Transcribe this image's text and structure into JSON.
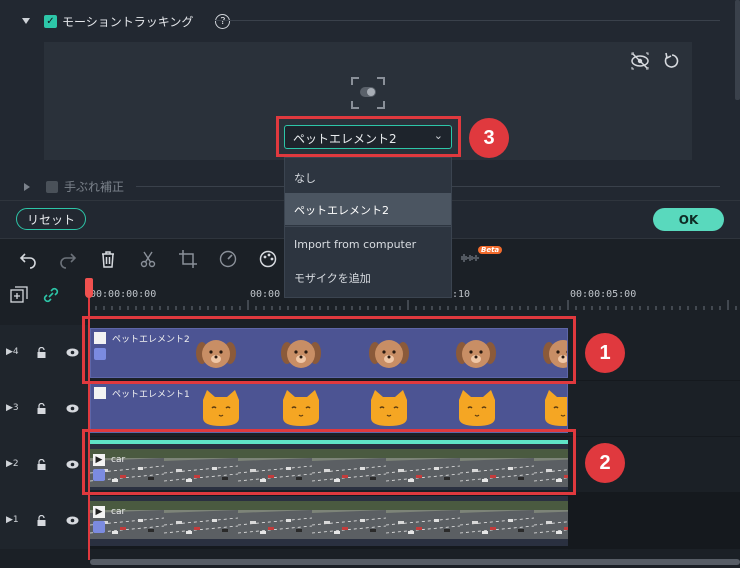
{
  "properties": {
    "motion_tracking_label": "モーショントラッキング",
    "help_symbol": "?",
    "selected_element": "ペットエレメント2",
    "stabilization_label": "手ぶれ補正",
    "reset_label": "リセット",
    "ok_label": "OK"
  },
  "dropdown": {
    "items": [
      "なし",
      "ペットエレメント2",
      "Import from computer",
      "モザイクを追加"
    ],
    "selected_index": 1
  },
  "toolbar": {
    "beta_label": "Beta",
    "icons": [
      "undo-icon",
      "redo-icon",
      "delete-icon",
      "cut-icon",
      "crop-icon",
      "speed-icon",
      "color-icon",
      "audio-icon"
    ]
  },
  "ruler": {
    "times": [
      "00:00:00:00",
      "00:00",
      ":10",
      "00:00:05:00"
    ]
  },
  "tracks": [
    {
      "number": "4",
      "clip_label": "ペットエレメント2",
      "type": "dog"
    },
    {
      "number": "3",
      "clip_label": "ペットエレメント1",
      "type": "cat"
    },
    {
      "number": "2",
      "clip_label": "car",
      "type": "video"
    },
    {
      "number": "1",
      "clip_label": "car",
      "type": "video"
    }
  ],
  "annotations": {
    "badge1": "1",
    "badge2": "2",
    "badge3": "3"
  },
  "colors": {
    "accent": "#2dc6a8",
    "highlight": "#e0393e",
    "clip": "#4c5493"
  }
}
